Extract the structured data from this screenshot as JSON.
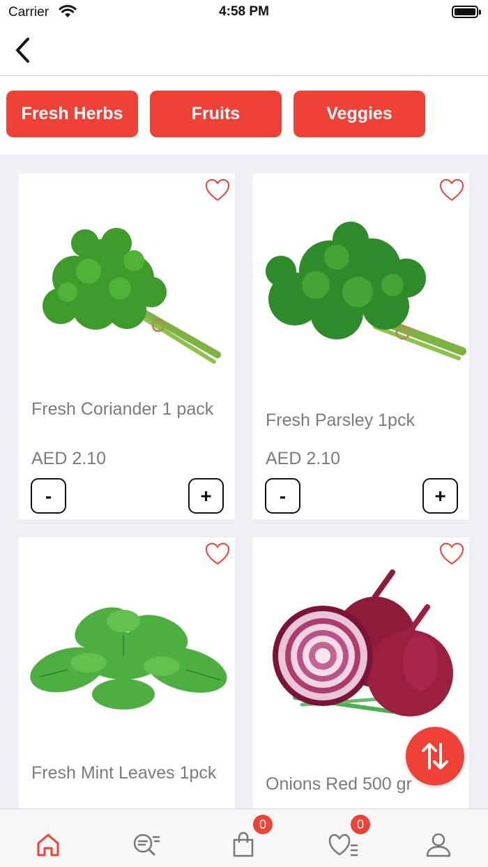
{
  "status_bar": {
    "carrier": "Carrier",
    "time": "4:58 PM"
  },
  "nav": {
    "back_icon": "chevron-left-icon"
  },
  "categories": [
    {
      "label": "Fresh Herbs"
    },
    {
      "label": "Fruits"
    },
    {
      "label": "Veggies"
    }
  ],
  "products": [
    {
      "name": "Fresh Coriander 1 pack",
      "price": "AED 2.10",
      "minus": "-",
      "plus": "+"
    },
    {
      "name": "Fresh Parsley 1pck",
      "price": "AED 2.10",
      "minus": "-",
      "plus": "+"
    },
    {
      "name": "Fresh Mint Leaves 1pck"
    },
    {
      "name": "Onions Red 500 gr"
    }
  ],
  "tab_bar": {
    "items": [
      {
        "icon": "home-icon"
      },
      {
        "icon": "search-list-icon"
      },
      {
        "icon": "shopping-bag-icon",
        "badge": "0"
      },
      {
        "icon": "wishlist-icon",
        "badge": "0"
      },
      {
        "icon": "profile-icon"
      }
    ]
  },
  "colors": {
    "accent": "#ef4136",
    "background": "#f0f0f4",
    "text_muted": "#7b7b7b"
  },
  "fab": {
    "icon": "sort-arrows-icon"
  }
}
